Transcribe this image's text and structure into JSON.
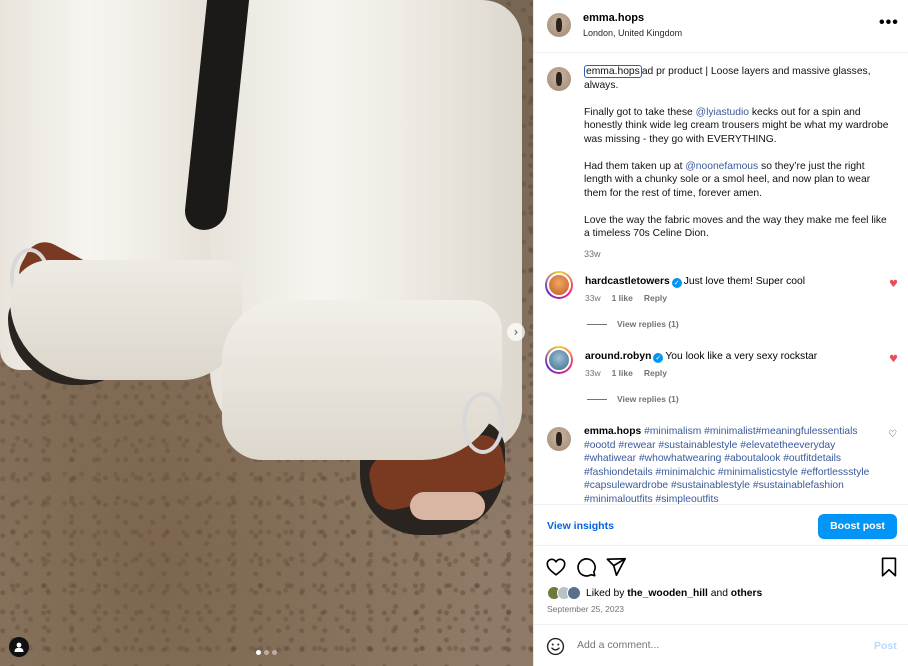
{
  "post": {
    "username": "emma.hops",
    "location": "London, United Kingdom",
    "more_label": "•••"
  },
  "caption": {
    "username": "emma.hops",
    "line1_rest": "ad pr product | Loose layers and massive glasses, always.",
    "p2_before": "Finally got to take these ",
    "p2_mention": "@lyiastudio",
    "p2_after": " kecks out for a spin and honestly think wide leg cream trousers might be what my wardrobe was missing - they go with EVERYTHING.",
    "p3_before": "Had them taken up at ",
    "p3_mention": "@noonefamous",
    "p3_after": " so they’re just the right length with a chunky sole or a smol heel, and now plan to wear them for the rest of time, forever amen.",
    "p4": "Love the way the fabric moves and the way they make me feel like a timeless 70s Celine Dion.",
    "time": "33w"
  },
  "comments": [
    {
      "username": "hardcastletowers",
      "text": "Just love them! Super cool",
      "time": "33w",
      "likes": "1 like",
      "reply": "Reply",
      "view_replies": "View replies (1)"
    },
    {
      "username": "around.robyn",
      "text": "You look like a very sexy rockstar",
      "time": "33w",
      "likes": "1 like",
      "reply": "Reply",
      "view_replies": "View replies (1)"
    }
  ],
  "tags_comment": {
    "username": "emma.hops",
    "text": "#minimalism #minimalist#meaningfulessentials #oootd #rewear #sustainablestyle #elevatetheeveryday #whatiwear #whowhatwearing #aboutalook #outfitdetails #fashiondetails #minimalchic #minimalisticstyle #effortlessstyle #capsulewardrobe #sustainablestyle #sustainablefashion #minimaloutfits #simpleoutfits"
  },
  "insights": {
    "view_label": "View insights",
    "boost_label": "Boost post"
  },
  "likes": {
    "prefix": "Liked by ",
    "user": "the_wooden_hill",
    "middle": " and ",
    "others": "others"
  },
  "date": "September 25, 2023",
  "add_comment": {
    "placeholder": "Add a comment...",
    "post_label": "Post"
  },
  "carousel": {
    "next_glyph": "›",
    "slide_count": 3,
    "active_slide": 1
  },
  "colors": {
    "accent": "#0095f6",
    "link": "#3a5a9b",
    "like_red": "#ed4956",
    "insights_blue": "#0064e0"
  },
  "glyphs": {
    "verified": "✓",
    "heart_filled": "♥",
    "heart_outline": "♡"
  }
}
